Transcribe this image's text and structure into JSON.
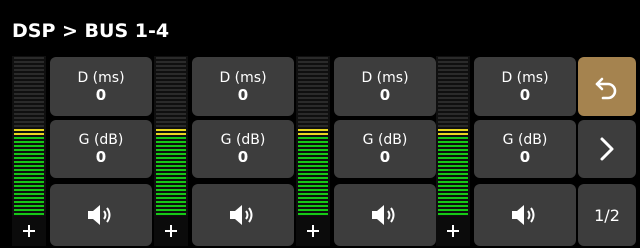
{
  "header": {
    "title": "DSP > BUS 1-4"
  },
  "channels": [
    {
      "delay_label": "D (ms)",
      "delay_value": "0",
      "gain_label": "G (dB)",
      "gain_value": "0",
      "mute_icon": "speaker-icon",
      "add_icon": "plus-icon",
      "meter_level": 0.55
    },
    {
      "delay_label": "D (ms)",
      "delay_value": "0",
      "gain_label": "G (dB)",
      "gain_value": "0",
      "mute_icon": "speaker-icon",
      "add_icon": "plus-icon",
      "meter_level": 0.55
    },
    {
      "delay_label": "D (ms)",
      "delay_value": "0",
      "gain_label": "G (dB)",
      "gain_value": "0",
      "mute_icon": "speaker-icon",
      "add_icon": "plus-icon",
      "meter_level": 0.55
    },
    {
      "delay_label": "D (ms)",
      "delay_value": "0",
      "gain_label": "G (dB)",
      "gain_value": "0",
      "mute_icon": "speaker-icon",
      "add_icon": "plus-icon",
      "meter_level": 0.55
    }
  ],
  "side": {
    "back_icon": "undo-arrow-icon",
    "next_icon": "chevron-right-icon",
    "page_label": "1/2"
  },
  "colors": {
    "background": "#000000",
    "tile": "#3d3d3d",
    "back_button": "#a5834f",
    "meter_green": "#16c916",
    "meter_yellow": "#e8d81f"
  }
}
